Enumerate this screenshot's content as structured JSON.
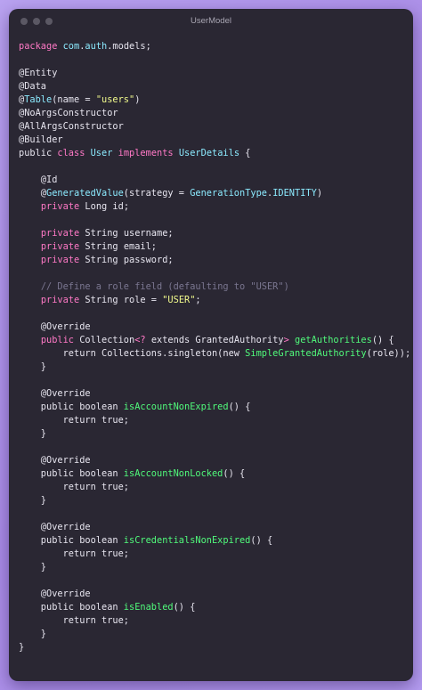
{
  "window": {
    "title": "UserModel"
  },
  "code": {
    "lines": [
      [
        [
          "kw",
          "package"
        ],
        [
          "pl",
          " "
        ],
        [
          "ty",
          "com"
        ],
        [
          "pl",
          "."
        ],
        [
          "ty",
          "auth"
        ],
        [
          "pl",
          ".models;"
        ]
      ],
      [],
      [
        [
          "pl",
          "@Entity"
        ]
      ],
      [
        [
          "pl",
          "@Data"
        ]
      ],
      [
        [
          "pl",
          "@"
        ],
        [
          "ty",
          "Table"
        ],
        [
          "pl",
          "(name = "
        ],
        [
          "str",
          "\"users\""
        ],
        [
          "pl",
          ")"
        ]
      ],
      [
        [
          "pl",
          "@NoArgsConstructor"
        ]
      ],
      [
        [
          "pl",
          "@AllArgsConstructor"
        ]
      ],
      [
        [
          "pl",
          "@Builder"
        ]
      ],
      [
        [
          "pl",
          "public "
        ],
        [
          "kw",
          "class"
        ],
        [
          "pl",
          " "
        ],
        [
          "ty",
          "User"
        ],
        [
          "pl",
          " "
        ],
        [
          "kw",
          "implements"
        ],
        [
          "pl",
          " "
        ],
        [
          "ty",
          "UserDetails"
        ],
        [
          "pl",
          " {"
        ]
      ],
      [],
      [
        [
          "pl",
          "    @Id"
        ]
      ],
      [
        [
          "pl",
          "    @"
        ],
        [
          "ty",
          "GeneratedValue"
        ],
        [
          "pl",
          "(strategy = "
        ],
        [
          "ty",
          "GenerationType"
        ],
        [
          "pl",
          "."
        ],
        [
          "ty",
          "IDENTITY"
        ],
        [
          "pl",
          ")"
        ]
      ],
      [
        [
          "pl",
          "    "
        ],
        [
          "kw",
          "private"
        ],
        [
          "pl",
          " Long id;"
        ]
      ],
      [],
      [
        [
          "pl",
          "    "
        ],
        [
          "kw",
          "private"
        ],
        [
          "pl",
          " String username;"
        ]
      ],
      [
        [
          "pl",
          "    "
        ],
        [
          "kw",
          "private"
        ],
        [
          "pl",
          " String email;"
        ]
      ],
      [
        [
          "pl",
          "    "
        ],
        [
          "kw",
          "private"
        ],
        [
          "pl",
          " String password;"
        ]
      ],
      [],
      [
        [
          "pl",
          "    "
        ],
        [
          "cm",
          "// Define a role field (defaulting to \"USER\")"
        ]
      ],
      [
        [
          "pl",
          "    "
        ],
        [
          "kw",
          "private"
        ],
        [
          "pl",
          " String role = "
        ],
        [
          "str",
          "\"USER\""
        ],
        [
          "pl",
          ";"
        ]
      ],
      [],
      [
        [
          "pl",
          "    @Override"
        ]
      ],
      [
        [
          "pl",
          "    "
        ],
        [
          "kw",
          "public"
        ],
        [
          "pl",
          " Collection"
        ],
        [
          "kw",
          "<?"
        ],
        [
          "pl",
          " extends GrantedAuthority"
        ],
        [
          "kw",
          ">"
        ],
        [
          "pl",
          " "
        ],
        [
          "fn",
          "getAuthorities"
        ],
        [
          "pl",
          "() {"
        ]
      ],
      [
        [
          "pl",
          "        return Collections.singleton(new "
        ],
        [
          "fn",
          "SimpleGrantedAuthority"
        ],
        [
          "pl",
          "(role));"
        ]
      ],
      [
        [
          "pl",
          "    }"
        ]
      ],
      [],
      [
        [
          "pl",
          "    @Override"
        ]
      ],
      [
        [
          "pl",
          "    public boolean "
        ],
        [
          "fn",
          "isAccountNonExpired"
        ],
        [
          "pl",
          "() {"
        ]
      ],
      [
        [
          "pl",
          "        return true;"
        ]
      ],
      [
        [
          "pl",
          "    }"
        ]
      ],
      [],
      [
        [
          "pl",
          "    @Override"
        ]
      ],
      [
        [
          "pl",
          "    public boolean "
        ],
        [
          "fn",
          "isAccountNonLocked"
        ],
        [
          "pl",
          "() {"
        ]
      ],
      [
        [
          "pl",
          "        return true;"
        ]
      ],
      [
        [
          "pl",
          "    }"
        ]
      ],
      [],
      [
        [
          "pl",
          "    @Override"
        ]
      ],
      [
        [
          "pl",
          "    public boolean "
        ],
        [
          "fn",
          "isCredentialsNonExpired"
        ],
        [
          "pl",
          "() {"
        ]
      ],
      [
        [
          "pl",
          "        return true;"
        ]
      ],
      [
        [
          "pl",
          "    }"
        ]
      ],
      [],
      [
        [
          "pl",
          "    @Override"
        ]
      ],
      [
        [
          "pl",
          "    public boolean "
        ],
        [
          "fn",
          "isEnabled"
        ],
        [
          "pl",
          "() {"
        ]
      ],
      [
        [
          "pl",
          "        return true;"
        ]
      ],
      [
        [
          "pl",
          "    }"
        ]
      ],
      [
        [
          "pl",
          "}"
        ]
      ]
    ]
  }
}
